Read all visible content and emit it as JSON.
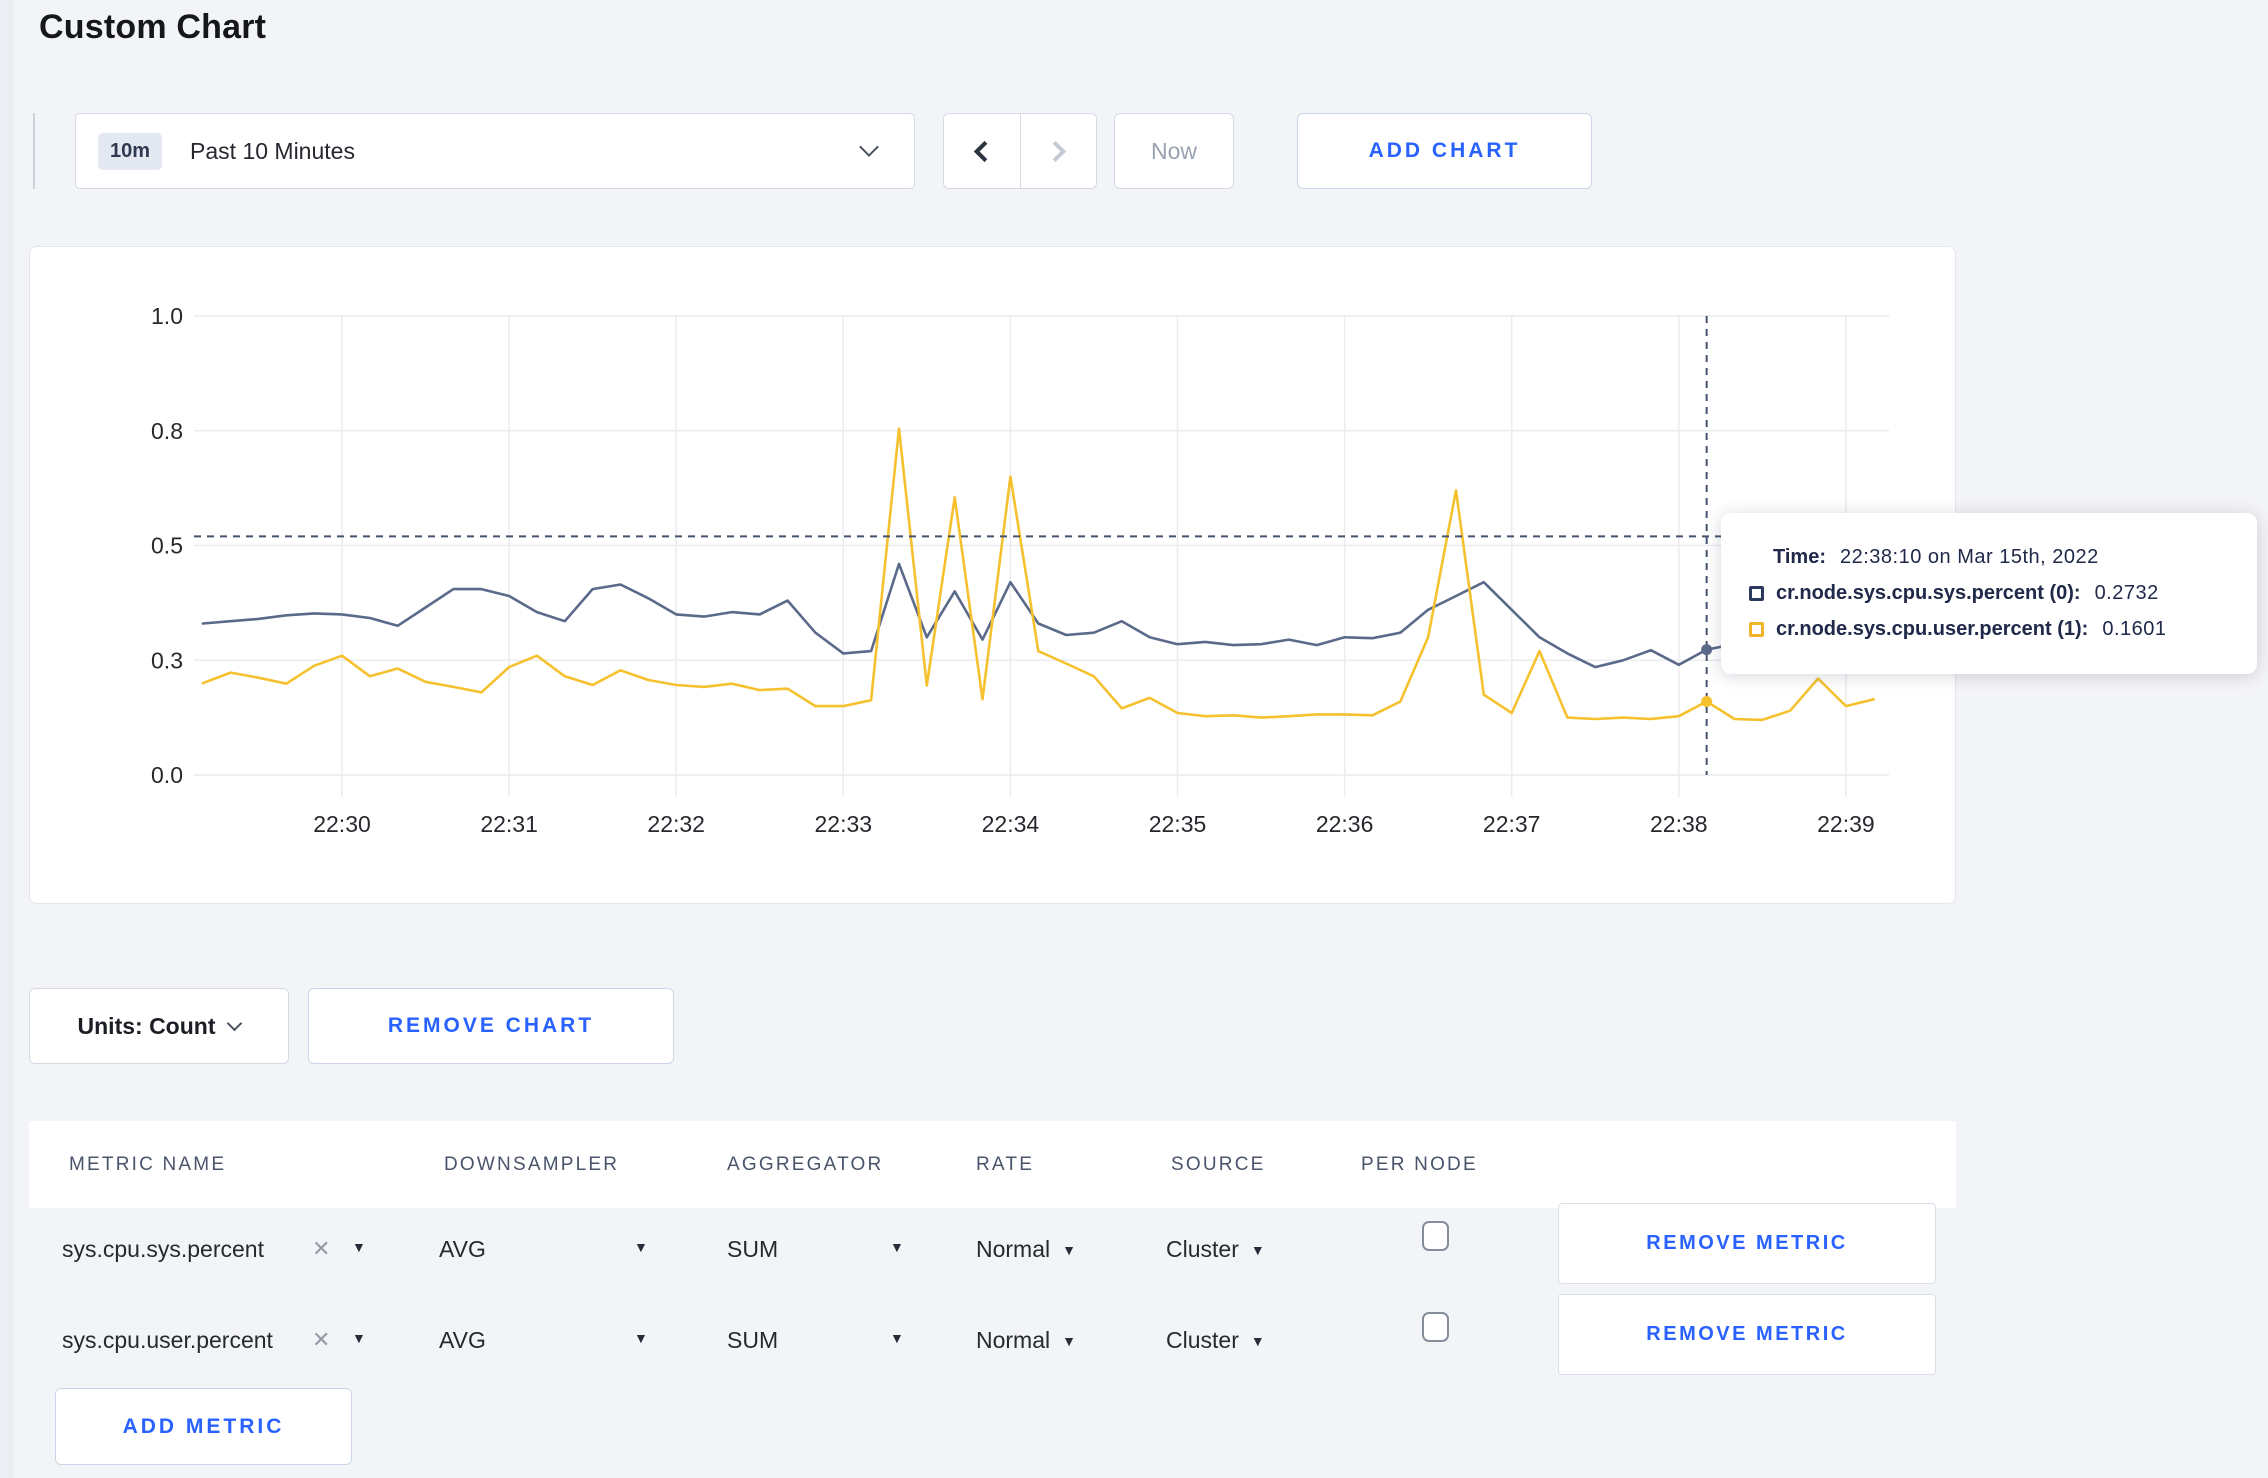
{
  "title": "Custom Chart",
  "toolbar": {
    "time_range": {
      "badge": "10m",
      "label": "Past 10 Minutes"
    },
    "now_label": "Now",
    "add_chart_label": "ADD CHART"
  },
  "chart_data": {
    "type": "line",
    "title": "",
    "xlabel": "",
    "ylabel": "",
    "ylim": [
      0,
      1.0
    ],
    "grid": true,
    "legend_position": "none",
    "x_ticks": [
      "22:30",
      "22:31",
      "22:32",
      "22:33",
      "22:34",
      "22:35",
      "22:36",
      "22:37",
      "22:38",
      "22:39"
    ],
    "y_tick_values": [
      0,
      0.25,
      0.5,
      0.75,
      1.0
    ],
    "y_tick_labels": [
      "0.0",
      "0.3",
      "0.5",
      "0.8",
      "1.0"
    ],
    "first_point_offset_seconds": -50,
    "step_seconds": 10,
    "x_start_time": "22:29:10",
    "series": [
      {
        "name": "cr.node.sys.cpu.sys.percent",
        "color": "#5b6a8a",
        "values": [
          0.33,
          0.335,
          0.34,
          0.348,
          0.352,
          0.35,
          0.342,
          0.325,
          0.365,
          0.405,
          0.405,
          0.39,
          0.355,
          0.335,
          0.405,
          0.415,
          0.385,
          0.35,
          0.345,
          0.355,
          0.35,
          0.38,
          0.31,
          0.265,
          0.27,
          0.46,
          0.3,
          0.4,
          0.295,
          0.42,
          0.33,
          0.305,
          0.31,
          0.335,
          0.3,
          0.285,
          0.29,
          0.283,
          0.285,
          0.295,
          0.283,
          0.3,
          0.298,
          0.31,
          0.36,
          0.39,
          0.42,
          0.36,
          0.3,
          0.265,
          0.235,
          0.25,
          0.272,
          0.24,
          0.2732,
          0.285,
          0.305,
          0.285,
          0.295,
          0.305,
          0.31
        ]
      },
      {
        "name": "cr.node.sys.cpu.user.percent",
        "color": "#f5c12e",
        "values": [
          0.2,
          0.223,
          0.212,
          0.199,
          0.238,
          0.26,
          0.215,
          0.232,
          0.203,
          0.192,
          0.18,
          0.235,
          0.26,
          0.215,
          0.196,
          0.228,
          0.207,
          0.196,
          0.192,
          0.199,
          0.185,
          0.188,
          0.15,
          0.15,
          0.163,
          0.755,
          0.195,
          0.605,
          0.165,
          0.65,
          0.27,
          0.243,
          0.215,
          0.145,
          0.168,
          0.135,
          0.128,
          0.13,
          0.125,
          0.128,
          0.132,
          0.132,
          0.13,
          0.16,
          0.3,
          0.62,
          0.175,
          0.135,
          0.27,
          0.125,
          0.122,
          0.125,
          0.122,
          0.128,
          0.1601,
          0.122,
          0.12,
          0.14,
          0.21,
          0.15,
          0.165
        ]
      }
    ],
    "crosshair": {
      "index": 54,
      "time": "22:38:10",
      "hover_y_value": 0.52
    }
  },
  "tooltip": {
    "time_label": "Time:",
    "time_value": "22:38:10 on Mar 15th, 2022",
    "series": [
      {
        "label": "cr.node.sys.cpu.sys.percent (0):",
        "value": "0.2732",
        "color": "#2b3a5c"
      },
      {
        "label": "cr.node.sys.cpu.user.percent (1):",
        "value": "0.1601",
        "color": "#f0b429"
      }
    ]
  },
  "units_row": {
    "units_label": "Units: Count",
    "remove_chart_label": "REMOVE CHART"
  },
  "metrics": {
    "headers": [
      "METRIC NAME",
      "DOWNSAMPLER",
      "AGGREGATOR",
      "RATE",
      "SOURCE",
      "PER NODE"
    ],
    "rows": [
      {
        "name": "sys.cpu.sys.percent",
        "downsampler": "AVG",
        "aggregator": "SUM",
        "rate": "Normal",
        "source": "Cluster",
        "per_node_checked": false,
        "remove_label": "REMOVE METRIC"
      },
      {
        "name": "sys.cpu.user.percent",
        "downsampler": "AVG",
        "aggregator": "SUM",
        "rate": "Normal",
        "source": "Cluster",
        "per_node_checked": false,
        "remove_label": "REMOVE METRIC"
      }
    ],
    "add_metric_label": "ADD METRIC"
  },
  "accent_color": "#2962ff"
}
